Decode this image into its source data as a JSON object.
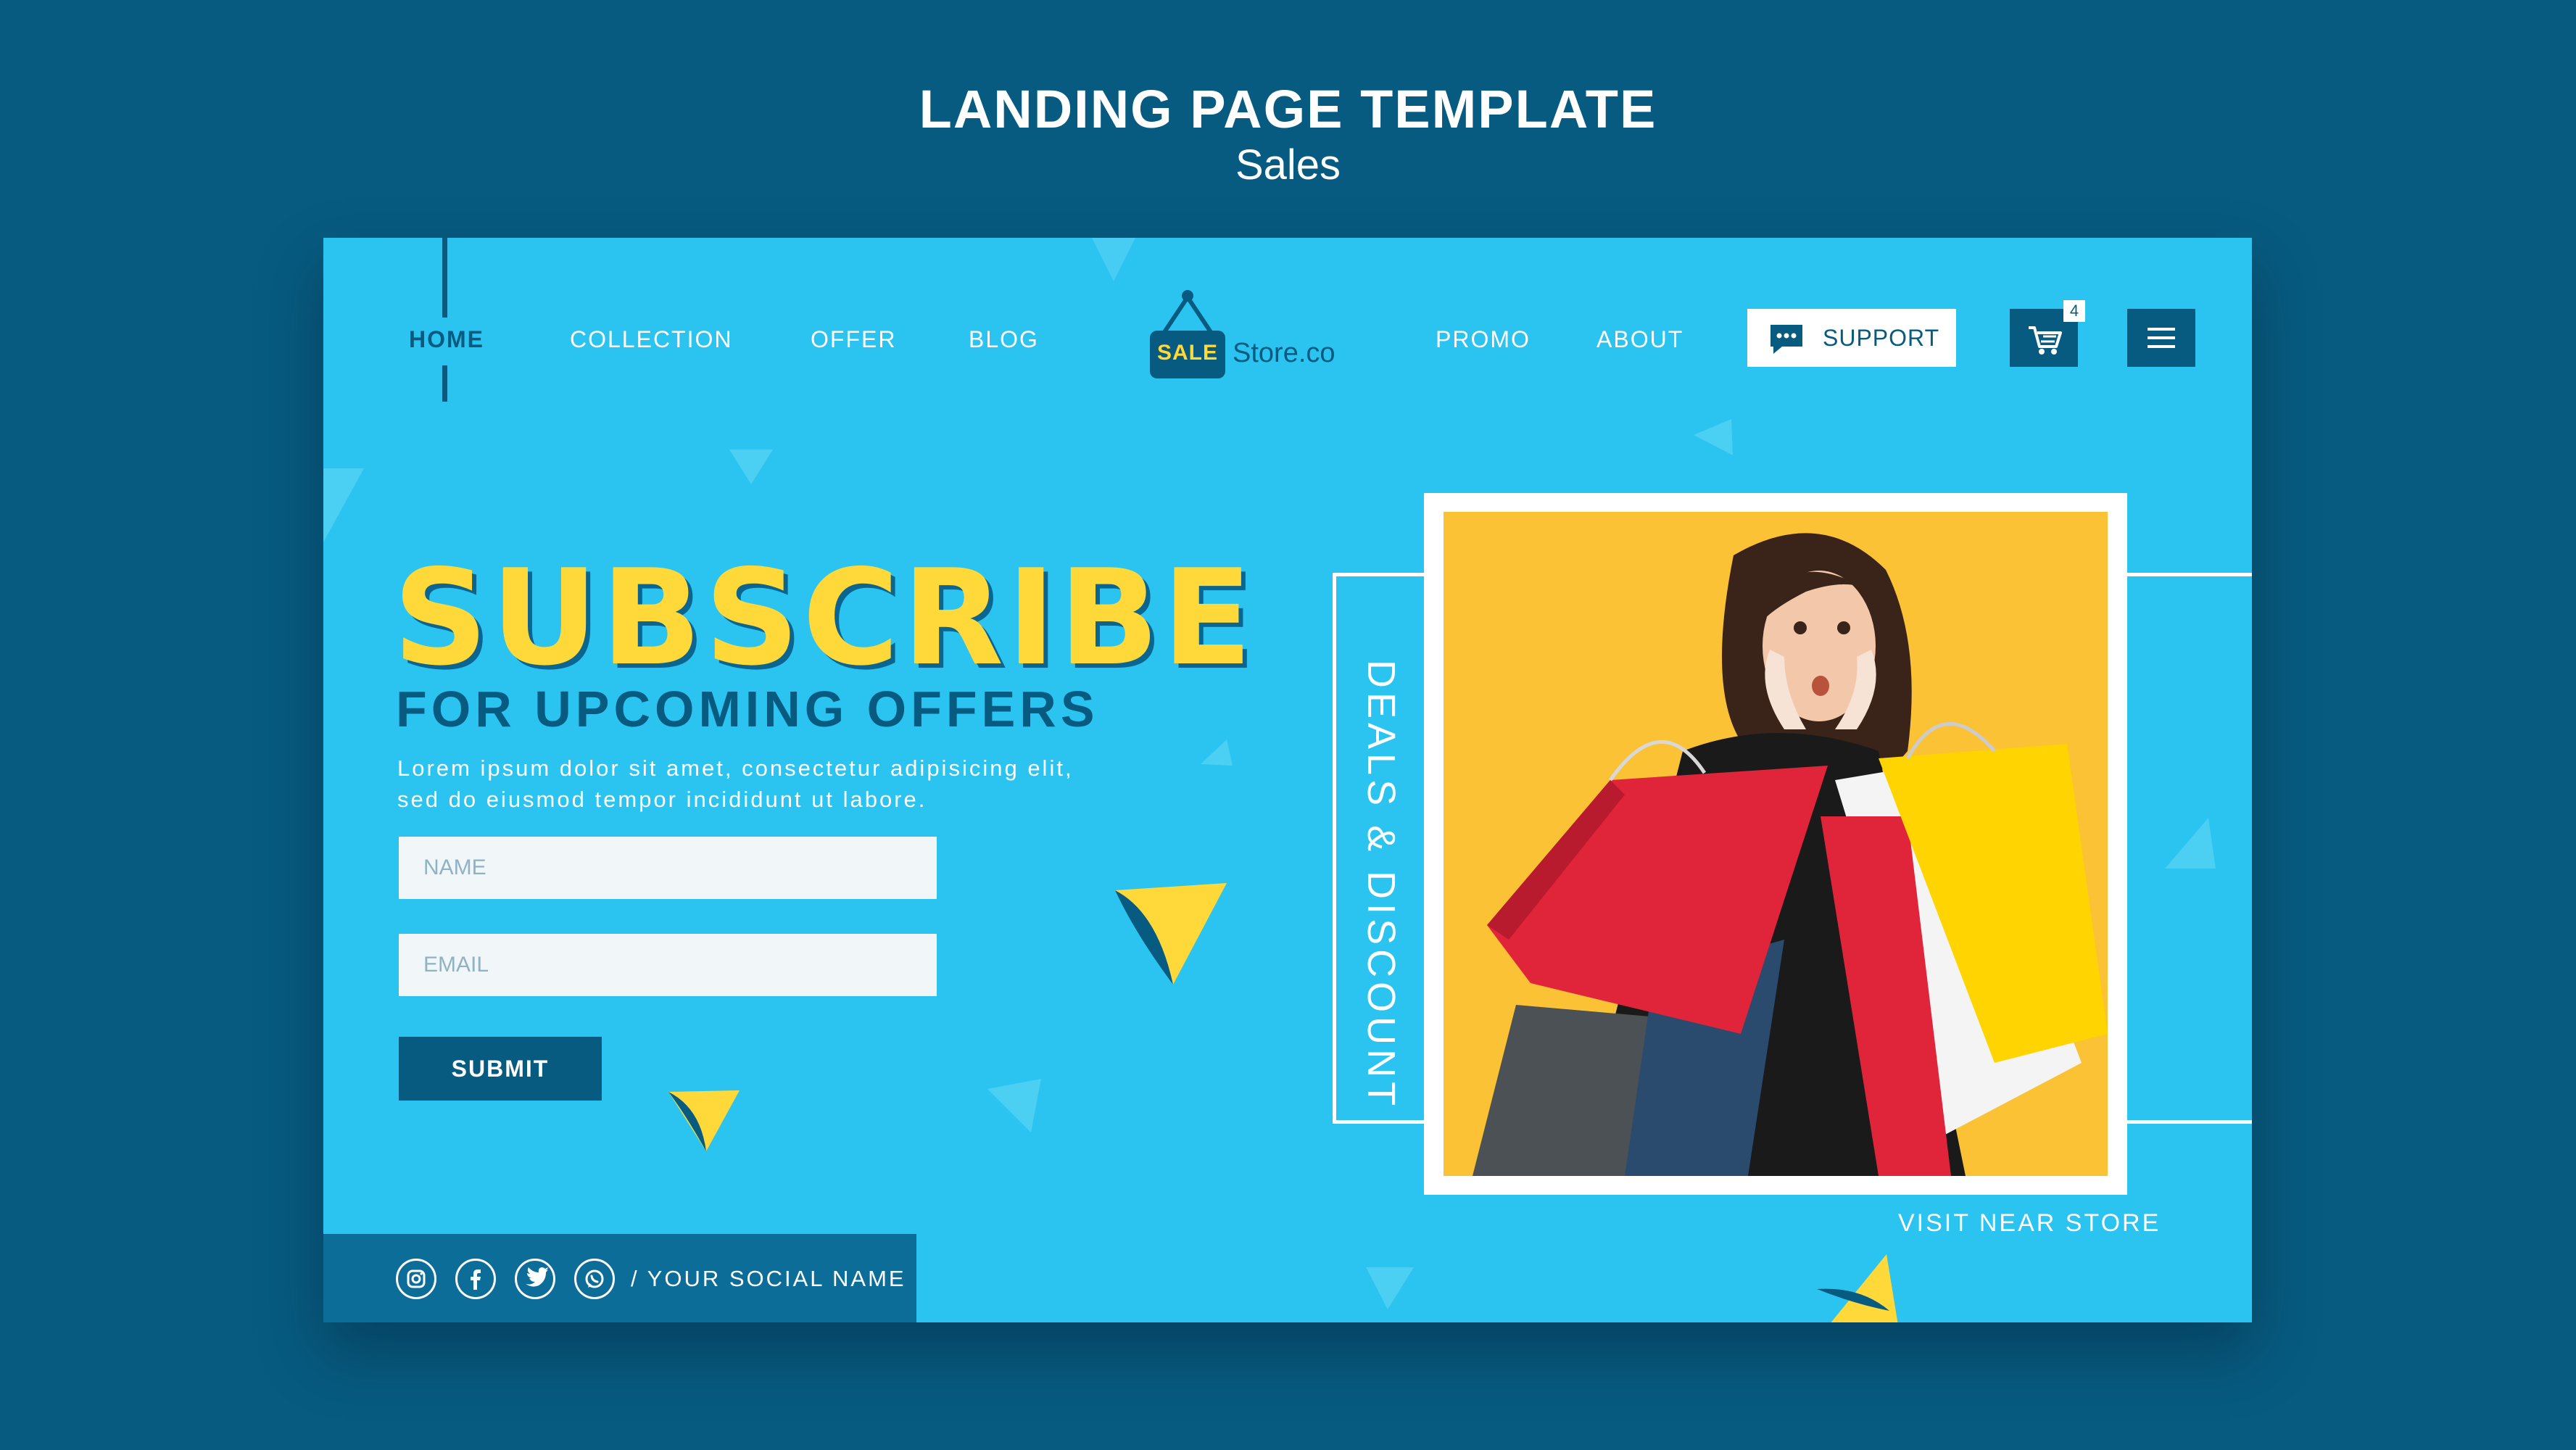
{
  "header": {
    "title": "LANDING PAGE TEMPLATE",
    "subtitle": "Sales"
  },
  "nav": {
    "items": [
      "HOME",
      "COLLECTION",
      "OFFER",
      "BLOG"
    ],
    "items_right": [
      "PROMO",
      "ABOUT"
    ],
    "active": "HOME",
    "logo": {
      "tag": "SALE",
      "text": "Store.co"
    },
    "support_label": "SUPPORT",
    "cart_count": "4",
    "icons": {
      "support": "chat-bubble-icon",
      "cart": "shopping-cart-icon",
      "menu": "hamburger-menu-icon"
    }
  },
  "hero": {
    "headline": "SUBSCRIBE",
    "subheadline": "FOR UPCOMING OFFERS",
    "body": "Lorem ipsum dolor sit amet, consectetur adipisicing elit, sed do eiusmod tempor incididunt ut labore.",
    "form": {
      "name_placeholder": "NAME",
      "email_placeholder": "EMAIL",
      "submit_label": "SUBMIT"
    }
  },
  "social": {
    "icons": [
      "instagram-icon",
      "facebook-icon",
      "twitter-icon",
      "whatsapp-icon"
    ],
    "name": "/ YOUR SOCIAL NAME"
  },
  "feature": {
    "vertical_label": "DEALS & DISCOUNT",
    "visit_label": "VISIT NEAR STORE",
    "image": "woman-with-shopping-bags"
  },
  "colors": {
    "background": "#075b80",
    "card": "#2bc4f0",
    "accent_yellow": "#ffd83a",
    "dark_blue": "#075b80"
  }
}
